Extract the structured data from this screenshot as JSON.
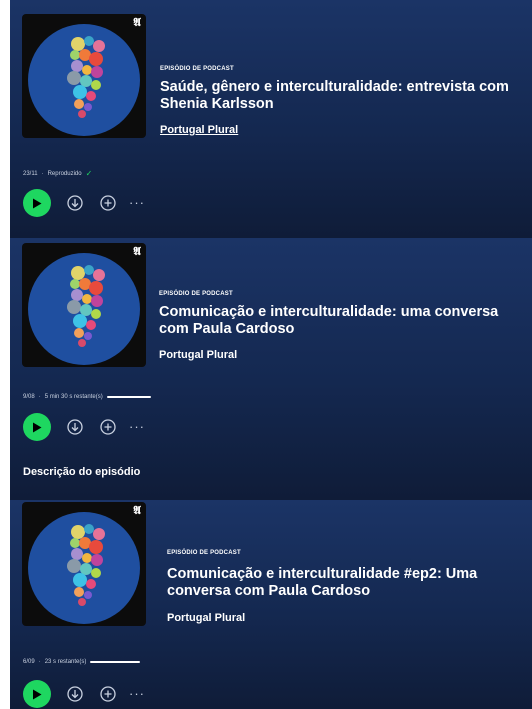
{
  "episodes": [
    {
      "kind": "EPISÓDIO DE PODCAST",
      "title_line1": "Saúde, gênero e interculturalidade: entrevista com",
      "title_line2": "Shenia Karlsson",
      "show": "Portugal Plural",
      "date": "23/11",
      "status": "Reproduzido",
      "progress": 1.0
    },
    {
      "kind": "EPISÓDIO DE PODCAST",
      "title_line1": "Comunicação e interculturalidade: uma conversa",
      "title_line2": "com Paula Cardoso",
      "show": "Portugal Plural",
      "date": "9/08",
      "status": "5 min 30 s restante(s)",
      "progress": 0.85,
      "section_label": "Descrição do episódio"
    },
    {
      "kind": "EPISÓDIO DE PODCAST",
      "title_line1": "Comunicação e interculturalidade #ep2: Uma",
      "title_line2": "conversa com Paula Cardoso",
      "show": "Portugal Plural",
      "date": "6/09",
      "status": "23 s restante(s)",
      "progress": 0.98
    }
  ],
  "separator": "·",
  "more_label": "···",
  "icons": {
    "play": "play-icon",
    "download": "download-icon",
    "add": "add-icon",
    "more": "more-options-icon",
    "check": "checkmark-icon",
    "cover_logo": "anchor-logo-icon"
  },
  "colors": {
    "accent": "#1ed760",
    "background": "#142850",
    "cover_circle": "#1f4fa0"
  }
}
